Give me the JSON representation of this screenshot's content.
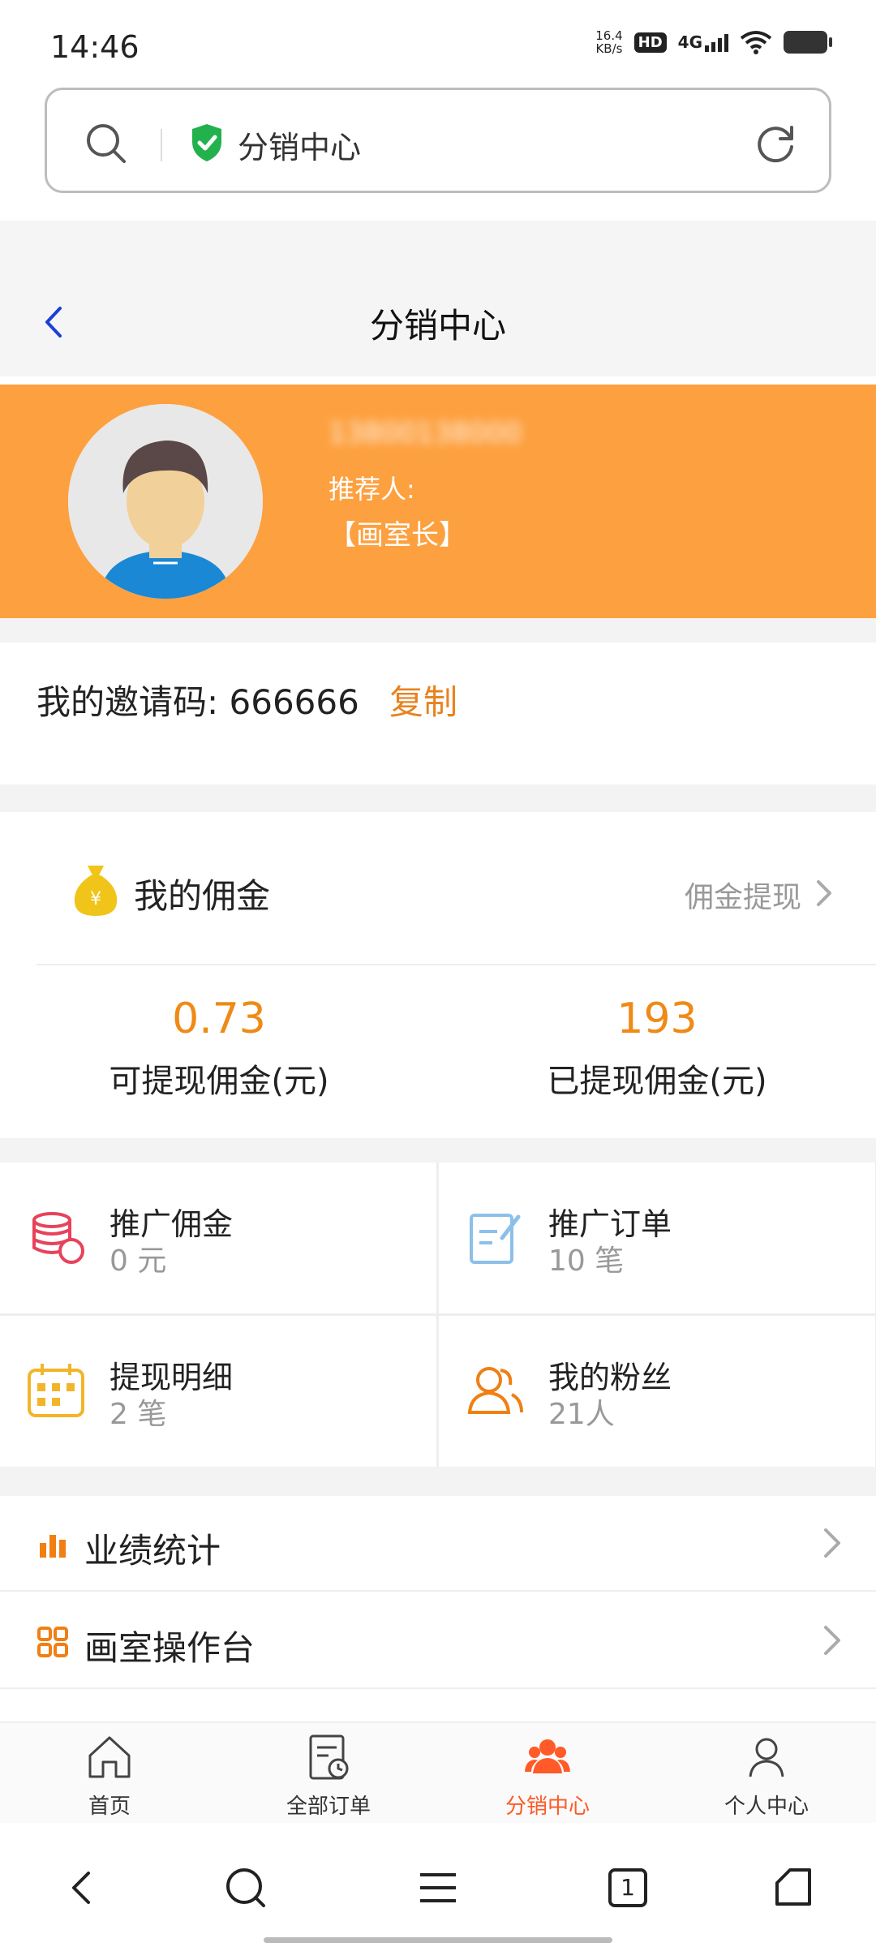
{
  "status_bar": {
    "time": "14:46",
    "speed_value": "16.4",
    "speed_unit": "KB/s",
    "hd": "HD",
    "network": "4G"
  },
  "browser": {
    "url_title": "分销中心"
  },
  "header": {
    "title": "分销中心"
  },
  "profile": {
    "phone_blurred": "13800138000",
    "referrer_label": "推荐人:",
    "shop_name": "【画室长】"
  },
  "invite": {
    "label": "我的邀请码: 666666",
    "copy_label": "复制"
  },
  "commission": {
    "title": "我的佣金",
    "withdraw_link": "佣金提现",
    "available_value": "0.73",
    "available_label": "可提现佣金(元)",
    "withdrawn_value": "193",
    "withdrawn_label": "已提现佣金(元)"
  },
  "grid": {
    "promo_commission_title": "推广佣金",
    "promo_commission_value": "0 元",
    "promo_orders_title": "推广订单",
    "promo_orders_value": "10 笔",
    "withdraw_detail_title": "提现明细",
    "withdraw_detail_value": "2 笔",
    "fans_title": "我的粉丝",
    "fans_value": "21人"
  },
  "menu": {
    "performance": "业绩统计",
    "studio_console": "画室操作台"
  },
  "bottom_nav": {
    "home": "首页",
    "orders": "全部订单",
    "distribution": "分销中心",
    "profile": "个人中心"
  },
  "system_nav": {
    "tabs_count": "1"
  },
  "colors": {
    "orange": "#fda03f",
    "accent": "#ef8a16",
    "active_nav": "#ff5a28"
  }
}
